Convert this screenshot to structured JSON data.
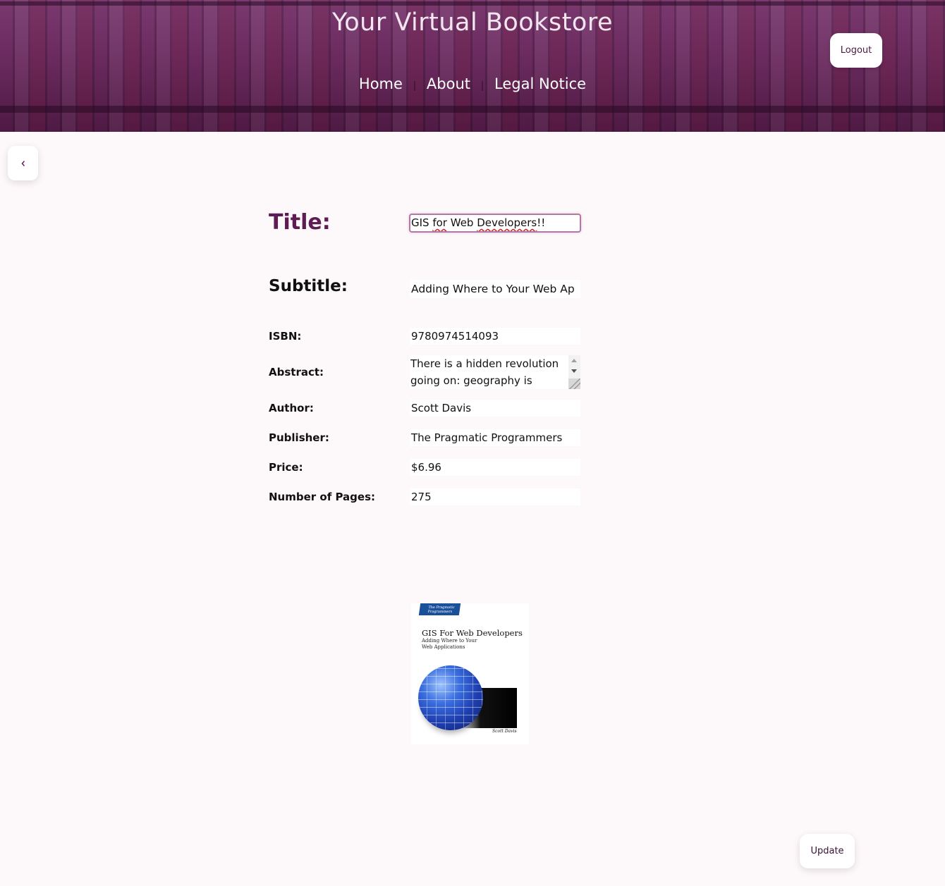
{
  "header": {
    "title": "Your Virtual Bookstore",
    "nav": [
      {
        "label": "Home"
      },
      {
        "label": "About"
      },
      {
        "label": "Legal Notice"
      }
    ],
    "logout_label": "Logout"
  },
  "back_icon": "chevron-left-icon",
  "form": {
    "title_label": "Title:",
    "title_value_part1": "GIS ",
    "title_value_part2": "for",
    "title_value_part3": " Web ",
    "title_value_part4": "Developers",
    "title_value_part5": "!!",
    "subtitle_label": "Subtitle:",
    "subtitle_value": "Adding Where to Your Web Ap",
    "isbn_label": "ISBN:",
    "isbn_value": "9780974514093",
    "abstract_label": "Abstract:",
    "abstract_value": "There is a hidden revolution going on: geography is",
    "author_label": "Author:",
    "author_value": "Scott Davis",
    "publisher_label": "Publisher:",
    "publisher_value": "The Pragmatic Programmers",
    "price_label": "Price:",
    "price_value": "$6.96",
    "pages_label": "Number of Pages:",
    "pages_value": "275"
  },
  "cover": {
    "banner": "The Pragmatic Programmers",
    "title": "GIS For Web Developers",
    "subtitle": "Adding Where to Your\nWeb Applications",
    "author": "Scott Davis"
  },
  "update_label": "Update",
  "colors": {
    "accent": "#5e1c55",
    "header_bg": "#5a1f4c",
    "page_bg": "#fdf8f9"
  }
}
